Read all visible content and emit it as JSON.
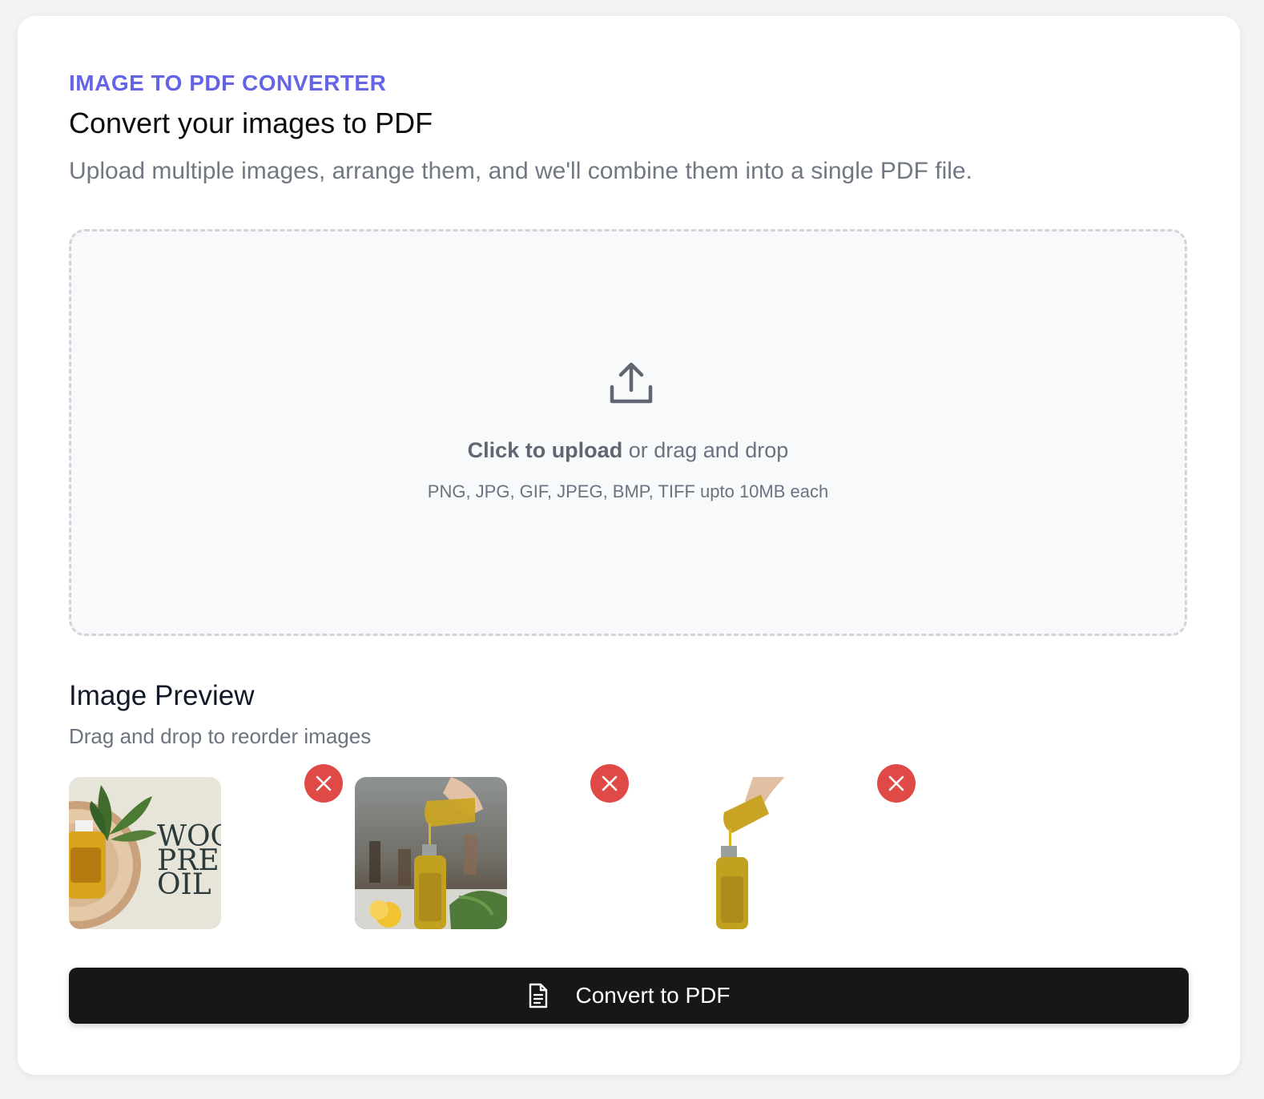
{
  "header": {
    "eyebrow": "IMAGE TO PDF CONVERTER",
    "title": "Convert your images to PDF",
    "subtitle": "Upload multiple images, arrange them, and we'll combine them into a single PDF file."
  },
  "upload": {
    "icon": "upload-icon",
    "action_strong": "Click to upload",
    "action_rest": " or drag and drop",
    "hint": "PNG, JPG, GIF, JPEG, BMP, TIFF upto 10MB each"
  },
  "preview": {
    "title": "Image Preview",
    "subtitle": "Drag and drop to reorder images",
    "images": [
      {
        "thumb_text": "WOOD\nPRESSED\nOIL",
        "remove_icon": "close-icon"
      },
      {
        "remove_icon": "close-icon"
      },
      {
        "remove_icon": "close-icon"
      }
    ]
  },
  "convert": {
    "label": "Convert to PDF",
    "icon": "document-icon"
  },
  "colors": {
    "accent": "#6464e6",
    "remove": "#df4a47",
    "button_bg": "#17171a"
  }
}
